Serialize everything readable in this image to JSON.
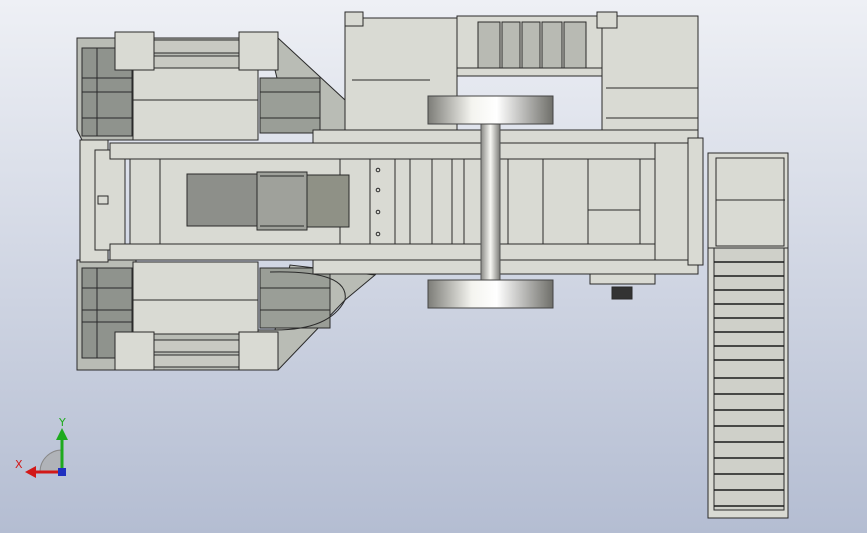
{
  "viewport": {
    "background_top": "#eef0f5",
    "background_bottom": "#b4bdd2",
    "part_fill": "#d9dad3",
    "part_stroke": "#2a2a2a",
    "shade_fill": "#8e928c"
  },
  "triad": {
    "x_label": "X",
    "y_label": "Y",
    "x_color": "#d21818",
    "y_color": "#1eaa1e",
    "z_color": "#2030c0"
  }
}
